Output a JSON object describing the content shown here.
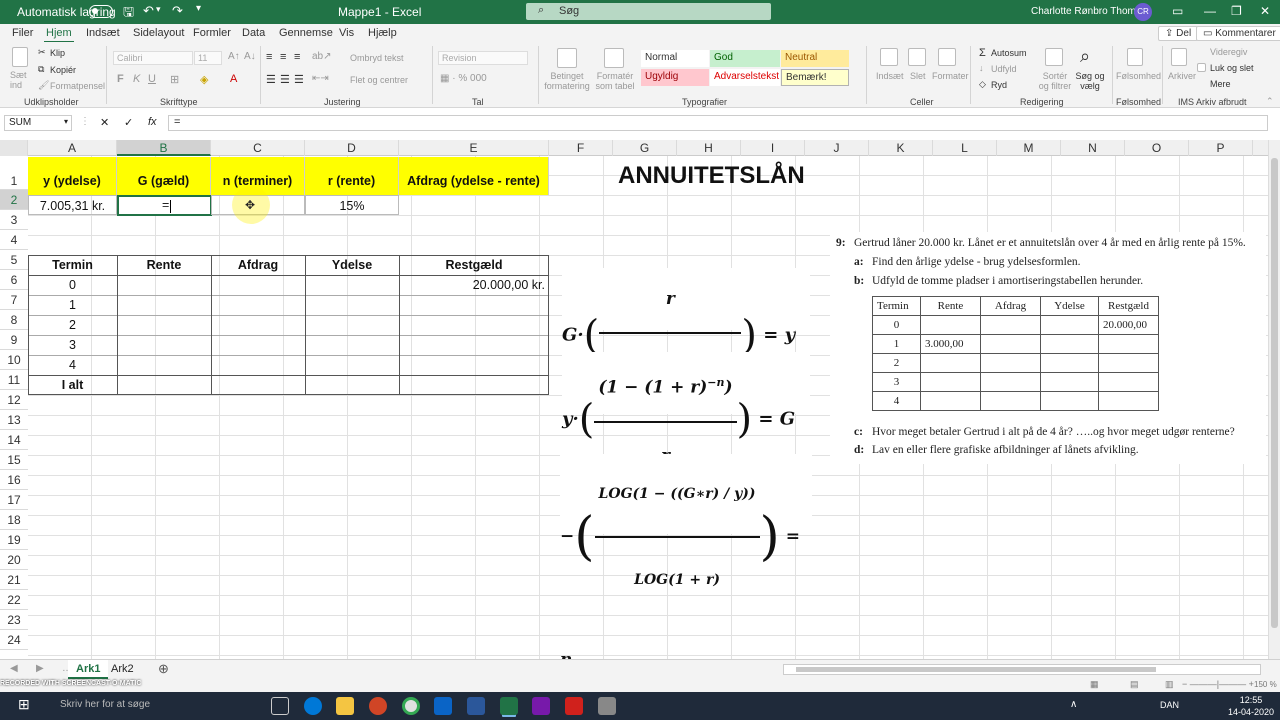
{
  "titlebar": {
    "autosave_label": "Automatisk lagring",
    "document_title": "Mappe1 - Excel",
    "search_placeholder": "Søg",
    "user_name": "Charlotte Rønbro Thomsen",
    "user_initials": "CR",
    "accent_color": "#217346"
  },
  "menu": {
    "items": [
      "Filer",
      "Hjem",
      "Indsæt",
      "Sidelayout",
      "Formler",
      "Data",
      "Gennemse",
      "Vis",
      "Hjælp"
    ],
    "active": "Hjem",
    "share_label": "Del",
    "comments_label": "Kommentarer"
  },
  "ribbon": {
    "clipboard": {
      "paste": "Sæt ind",
      "cut": "Klip",
      "copy": "Kopiér",
      "format_painter": "Formatpensel",
      "group": "Udklipsholder"
    },
    "font": {
      "font_name": "Calibri",
      "font_size": "11",
      "group": "Skrifttype"
    },
    "alignment": {
      "wrap": "Ombryd tekst",
      "merge": "Flet og centrer",
      "group": "Justering"
    },
    "number": {
      "format": "Revision",
      "group": "Tal"
    },
    "styles": {
      "cond_format": "Betinget formatering",
      "format_table": "Formatér som tabel",
      "items": [
        "Normal",
        "God",
        "Neutral",
        "Ugyldig",
        "Advarselstekst",
        "Bemærk!"
      ],
      "group": "Typografier"
    },
    "cells": {
      "insert": "Indsæt",
      "delete": "Slet",
      "format": "Formater",
      "group": "Celler"
    },
    "editing": {
      "autosum": "Autosum",
      "fill": "Udfyld",
      "clear": "Ryd",
      "sort": "Sortér og filtrer",
      "find": "Søg og vælg",
      "group": "Redigering"
    },
    "sensitivity": {
      "label": "Følsomhed",
      "group": "Følsomhed"
    },
    "archive": {
      "archive": "Arkiver",
      "video": "Videregiv",
      "close_send": "Luk og slet",
      "more": "Mere",
      "group": "IMS Arkiv afbrudt"
    }
  },
  "formula_bar": {
    "name_box": "SUM",
    "cancel": "✕",
    "enter": "✓",
    "fx": "fx",
    "content": "="
  },
  "grid": {
    "columns": [
      "A",
      "B",
      "C",
      "D",
      "E",
      "F",
      "G",
      "H",
      "I",
      "J",
      "K",
      "L",
      "M",
      "N",
      "O",
      "P"
    ],
    "rows": [
      "1",
      "2",
      "3",
      "4",
      "5",
      "6",
      "7",
      "8",
      "9",
      "10",
      "11",
      "12",
      "13",
      "14",
      "15",
      "16",
      "17",
      "18",
      "19",
      "20",
      "21",
      "22",
      "23",
      "24"
    ],
    "header_row": [
      "y (ydelse)",
      "G (gæld)",
      "n (terminer)",
      "r (rente)",
      "Afdrag (ydelse - rente)"
    ],
    "row2": {
      "a": "7.005,31 kr.",
      "b": "=",
      "c": "",
      "d": "15%"
    },
    "table_headers": [
      "Termin",
      "Rente",
      "Afdrag",
      "Ydelse",
      "Restgæld"
    ],
    "termins": [
      "0",
      "1",
      "2",
      "3",
      "4",
      "I alt"
    ],
    "restgaeld_0": "20.000,00 kr."
  },
  "annotation": {
    "title": "ANNUITETSLÅN"
  },
  "problem": {
    "number": "9:",
    "intro": "Gertrud låner 20.000 kr. Lånet er et annuitetslån over 4 år med en årlig rente på 15%.",
    "a_label": "a:",
    "a_text": "Find den årlige ydelse - brug ydelsesformlen.",
    "b_label": "b:",
    "b_text": "Udfyld de tomme pladser i amortiseringstabellen herunder.",
    "table_headers": [
      "Termin",
      "Rente",
      "Afdrag",
      "Ydelse",
      "Restgæld"
    ],
    "table_termins": [
      "0",
      "1",
      "2",
      "3",
      "4"
    ],
    "restgaeld_0": "20.000,00",
    "rente_1": "3.000,00",
    "c_label": "c:",
    "c_text": "Hvor meget betaler Gertrud i alt på de 4 år? …..og hvor meget udgør renterne?",
    "d_label": "d:",
    "d_text": "Lav en eller flere grafiske afbildninger af lånets afvikling."
  },
  "sheets": {
    "tabs": [
      "Ark1",
      "Ark2"
    ],
    "active": "Ark1"
  },
  "status": {
    "zoom": "150 %"
  },
  "taskbar": {
    "search_placeholder": "Skriv her for at søge",
    "language": "DAN",
    "time": "12:55",
    "date": "14-04-2020",
    "watermark": "RECORDED WITH SCREENCAST-O-MATIC"
  }
}
